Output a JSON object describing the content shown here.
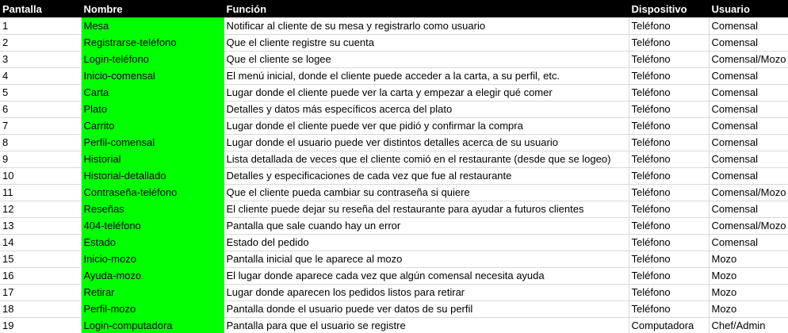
{
  "headers": {
    "pantalla": "Pantalla",
    "nombre": "Nombre",
    "funcion": "Función",
    "dispositivo": "Dispositivo",
    "usuario": "Usuario"
  },
  "colors": {
    "header_bg": "#000000",
    "header_text": "#ffffff",
    "nombre_bg": "#00ff00"
  },
  "rows": [
    {
      "pantalla": "1",
      "nombre": "Mesa",
      "funcion": "Notificar al cliente de su mesa y registrarlo como usuario",
      "dispositivo": "Teléfono",
      "usuario": "Comensal"
    },
    {
      "pantalla": "2",
      "nombre": "Registrarse-teléfono",
      "funcion": "Que el cliente registre su cuenta",
      "dispositivo": "Teléfono",
      "usuario": "Comensal"
    },
    {
      "pantalla": "3",
      "nombre": "Login-teléfono",
      "funcion": "Que el cliente se logee",
      "dispositivo": "Teléfono",
      "usuario": "Comensal/Mozo"
    },
    {
      "pantalla": "4",
      "nombre": "Inicio-comensal",
      "funcion": "El menú inicial, donde el cliente puede acceder a la carta, a su perfil, etc.",
      "dispositivo": "Teléfono",
      "usuario": "Comensal"
    },
    {
      "pantalla": "5",
      "nombre": "Carta",
      "funcion": "Lugar donde el cliente puede ver la carta y empezar a elegir qué comer",
      "dispositivo": "Teléfono",
      "usuario": "Comensal"
    },
    {
      "pantalla": "6",
      "nombre": "Plato",
      "funcion": "Detalles y datos más específicos acerca del plato",
      "dispositivo": "Teléfono",
      "usuario": "Comensal"
    },
    {
      "pantalla": "7",
      "nombre": "Carrito",
      "funcion": "Lugar donde el cliente puede ver que pidió y confirmar la compra",
      "dispositivo": "Teléfono",
      "usuario": "Comensal"
    },
    {
      "pantalla": "8",
      "nombre": "Perfil-comensal",
      "funcion": "Lugar donde el usuario puede ver distintos detalles acerca de su usuario",
      "dispositivo": "Teléfono",
      "usuario": "Comensal"
    },
    {
      "pantalla": "9",
      "nombre": "Historial",
      "funcion": "Lista detallada de veces que el cliente comió en el restaurante (desde que se logeo)",
      "dispositivo": "Teléfono",
      "usuario": "Comensal"
    },
    {
      "pantalla": "10",
      "nombre": "Historial-detallado",
      "funcion": "Detalles y especificaciones de cada vez que fue al restaurante",
      "dispositivo": "Teléfono",
      "usuario": "Comensal"
    },
    {
      "pantalla": "11",
      "nombre": "Contraseña-teléfono",
      "funcion": "Que el cliente pueda cambiar su contraseña si quiere",
      "dispositivo": "Teléfono",
      "usuario": "Comensal/Mozo"
    },
    {
      "pantalla": "12",
      "nombre": "Reseñas",
      "funcion": "El cliente puede dejar su reseña del restaurante para ayudar a futuros clientes",
      "dispositivo": "Teléfono",
      "usuario": "Comensal"
    },
    {
      "pantalla": "13",
      "nombre": "404-teléfono",
      "funcion": "Pantalla que sale cuando hay un error",
      "dispositivo": "Teléfono",
      "usuario": "Comensal/Mozo"
    },
    {
      "pantalla": "14",
      "nombre": "Estado",
      "funcion": "Estado del pedido",
      "dispositivo": "Teléfono",
      "usuario": "Comensal"
    },
    {
      "pantalla": "15",
      "nombre": "Inicio-mozo",
      "funcion": "Pantalla inicial que le aparece al mozo",
      "dispositivo": "Teléfono",
      "usuario": "Mozo"
    },
    {
      "pantalla": "16",
      "nombre": "Ayuda-mozo",
      "funcion": "El lugar donde aparece cada vez que algún comensal necesita ayuda",
      "dispositivo": "Teléfono",
      "usuario": "Mozo"
    },
    {
      "pantalla": "17",
      "nombre": "Retirar",
      "funcion": "Lugar donde aparecen los pedidos listos para retirar",
      "dispositivo": "Teléfono",
      "usuario": "Mozo"
    },
    {
      "pantalla": "18",
      "nombre": "Perfil-mozo",
      "funcion": "Pantalla donde el usuario puede ver datos de su perfil",
      "dispositivo": "Teléfono",
      "usuario": "Mozo"
    },
    {
      "pantalla": "19",
      "nombre": "Login-computadora",
      "funcion": "Pantalla para que el usuario se registre",
      "dispositivo": "Computadora",
      "usuario": "Chef/Admin"
    }
  ]
}
